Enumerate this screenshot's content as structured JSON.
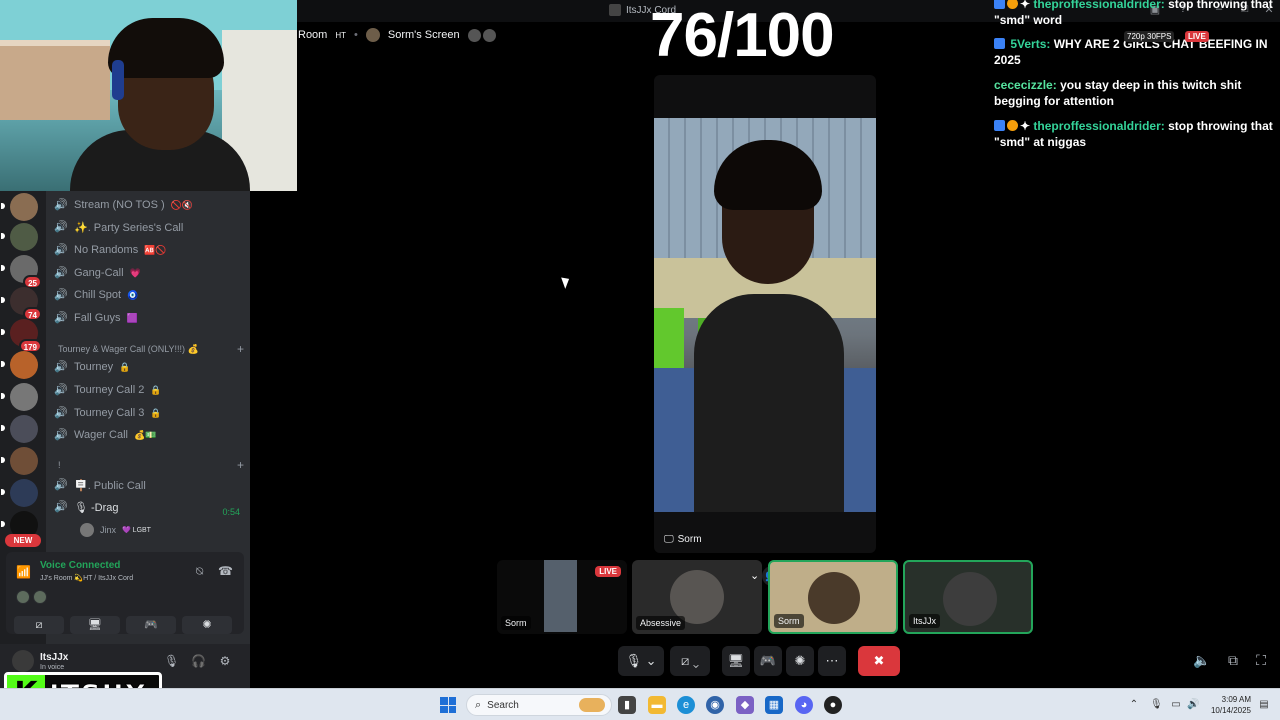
{
  "window": {
    "title": "ItsJJx Cord"
  },
  "stage": {
    "room_label": "Room",
    "room_suffix": "HT",
    "screen_label": "Sorm's Screen",
    "score": "76/100",
    "main_video_label": "Sorm"
  },
  "channels": {
    "items": [
      {
        "label": "Stream (NO TOS )",
        "emoji": "🚫🔇"
      },
      {
        "label": "✨. Party Series's Call",
        "emoji": ""
      },
      {
        "label": "No Randoms",
        "emoji": "🆎🚫"
      },
      {
        "label": "Gang-Call",
        "emoji": "💗"
      },
      {
        "label": "Chill Spot",
        "emoji": "🧿"
      },
      {
        "label": "Fall Guys",
        "emoji": "🟪"
      }
    ],
    "category1": "Tourney & Wager Call (ONLY!!!) 💰",
    "items2": [
      {
        "label": "Tourney",
        "emoji": "🔒"
      },
      {
        "label": "Tourney Call 2",
        "emoji": "🔒"
      },
      {
        "label": "Tourney Call 3",
        "emoji": "🔒"
      },
      {
        "label": "Wager Call",
        "emoji": "💰💵"
      }
    ],
    "category2": "!",
    "items3": [
      {
        "label": "🪧. Public Call",
        "emoji": ""
      },
      {
        "label": "🎙 -Drag",
        "emoji": ""
      }
    ],
    "drag_time": "0:54",
    "voice_user": "Jinx",
    "voice_user_tag": "💜 LGBT"
  },
  "guilds": {
    "badges": [
      "25",
      "74",
      "179"
    ],
    "new_label": "NEW"
  },
  "voice_panel": {
    "title": "Voice Connected",
    "subtitle": "JJ's Room 💫HT / ItsJJx Cord"
  },
  "user_panel": {
    "name": "ItsJJx",
    "status": "In voice"
  },
  "brand": {
    "k": "K",
    "text": "ITSJJX"
  },
  "chat": {
    "msg1_name": "theproffessionaldrider:",
    "msg1_text": "stop throwing that \"smd\" word",
    "msg2_name": "5Verts:",
    "msg2_text": "WHY ARE 2 GIRLS CHAT BEEFING IN 2025",
    "msg3_name": "cececizzle:",
    "msg3_text": "you stay deep in this twitch shit begging for attention",
    "msg4_name": "theproffessionaldrider:",
    "msg4_text": "stop throwing that \"smd\" at niggas",
    "quality": "720p 30FPS",
    "live": "LIVE"
  },
  "tiles": {
    "t1_label": "Sorm",
    "t1_live": "LIVE",
    "t2_label": "Absessive",
    "t3_label": "Sorm",
    "t4_label": "ItsJJx"
  },
  "taskbar": {
    "search_placeholder": "Search",
    "time": "3:09 AM",
    "date": "10/14/2025"
  },
  "colors": {
    "accent": "#23a55a",
    "danger": "#da373c",
    "brand": "#53fc18"
  }
}
